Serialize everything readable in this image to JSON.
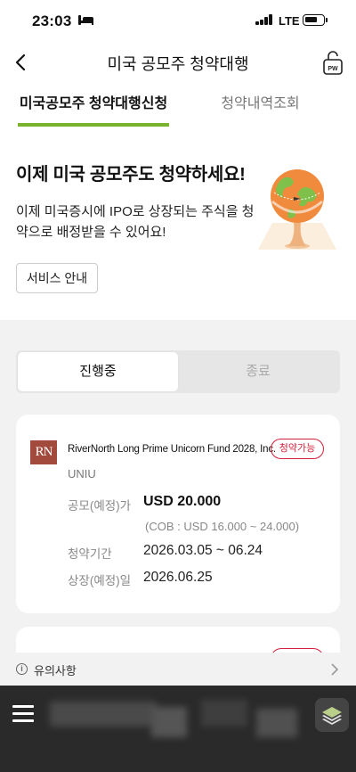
{
  "status_bar": {
    "time": "23:03",
    "network": "LTE"
  },
  "header": {
    "title": "미국 공모주 청약대행",
    "pw_label": "PW"
  },
  "tabs": [
    {
      "label": "미국공모주 청약대행신청",
      "active": true
    },
    {
      "label": "청약내역조회",
      "active": false
    }
  ],
  "promo": {
    "headline": "이제 미국 공모주도 청약하세요!",
    "description": "이제 미국증시에 IPO로 상장되는 주식을 청약으로 배정받을 수 있어요!",
    "service_button": "서비스 안내"
  },
  "status_toggle": [
    {
      "label": "진행중",
      "selected": true
    },
    {
      "label": "종료",
      "selected": false
    }
  ],
  "offerings": [
    {
      "logo_text": "RN",
      "fund_name": "RiverNorth Long Prime Unicorn Fund 2028, Inc.",
      "status": "청약가능",
      "ticker": "UNIU",
      "price_label": "공모(예정)가",
      "price": "USD 20.000",
      "cob_range": "(COB : USD 16.000 ~ 24.000)",
      "period_label": "청약기간",
      "period": "2026.03.05 ~ 06.24",
      "listing_label": "상장(예정)일",
      "listing_date": "2026.06.25"
    }
  ],
  "notice": {
    "label": "유의사항"
  },
  "colors": {
    "accent_green": "#7ab32e",
    "badge_red": "#d3203b",
    "logo_brown": "#a24a3c",
    "bottom_bar": "#2a2a2a"
  }
}
